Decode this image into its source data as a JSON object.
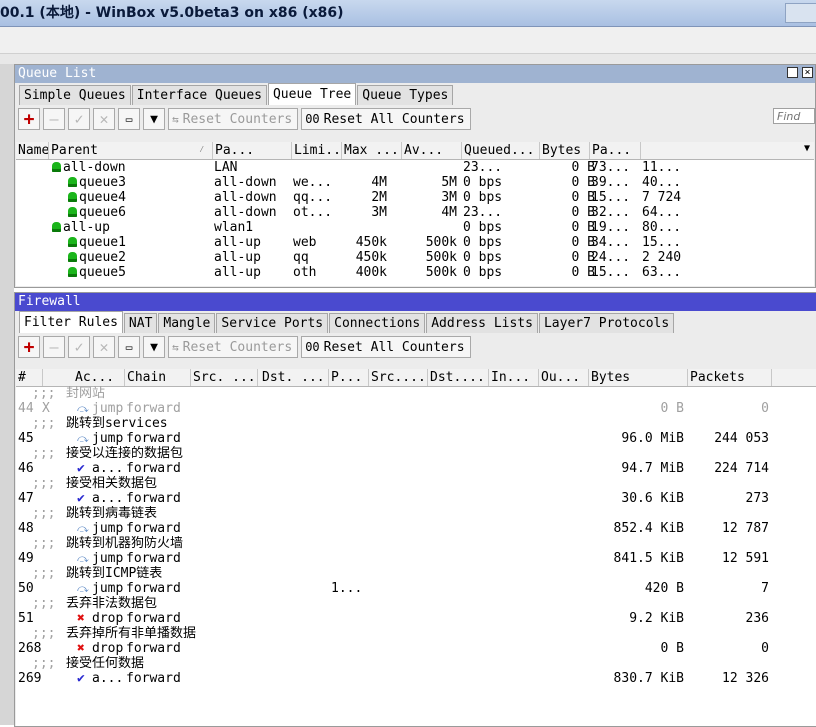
{
  "window": {
    "title": "00.1 (本地) - WinBox v5.0beta3 on x86 (x86)"
  },
  "queue_panel": {
    "title": "Queue List",
    "tabs": [
      "Simple Queues",
      "Interface Queues",
      "Queue Tree",
      "Queue Types"
    ],
    "active_tab": "Queue Tree",
    "reset_counters": "Reset Counters",
    "reset_all_prefix": "00",
    "reset_all": "Reset All Counters",
    "find_placeholder": "Find",
    "columns": [
      "Name",
      "Parent",
      "Pa...",
      "Limi...",
      "Max ...",
      "Av...",
      "Queued...",
      "Bytes",
      "Pa..."
    ],
    "rows": [
      {
        "name": "all-down",
        "parent": "LAN",
        "packet": "",
        "limit": "",
        "max": "",
        "avg": "23...",
        "queued": "0 B",
        "bytes": "73...",
        "packets": "11...",
        "level": 0
      },
      {
        "name": "queue3",
        "parent": "all-down",
        "packet": "we...",
        "limit": "4M",
        "max": "5M",
        "avg": "0 bps",
        "queued": "0 B",
        "bytes": "39...",
        "packets": "40...",
        "level": 1
      },
      {
        "name": "queue4",
        "parent": "all-down",
        "packet": "qq...",
        "limit": "2M",
        "max": "3M",
        "avg": "0 bps",
        "queued": "0 B",
        "bytes": "15...",
        "packets": "7 724",
        "level": 1
      },
      {
        "name": "queue6",
        "parent": "all-down",
        "packet": "ot...",
        "limit": "3M",
        "max": "4M",
        "avg": "23...",
        "queued": "0 B",
        "bytes": "32...",
        "packets": "64...",
        "level": 1
      },
      {
        "name": "all-up",
        "parent": "wlan1",
        "packet": "",
        "limit": "",
        "max": "",
        "avg": "0 bps",
        "queued": "0 B",
        "bytes": "19...",
        "packets": "80...",
        "level": 0
      },
      {
        "name": "queue1",
        "parent": "all-up",
        "packet": "web",
        "limit": "450k",
        "max": "500k",
        "avg": "0 bps",
        "queued": "0 B",
        "bytes": "34...",
        "packets": "15...",
        "level": 1
      },
      {
        "name": "queue2",
        "parent": "all-up",
        "packet": "qq",
        "limit": "450k",
        "max": "500k",
        "avg": "0 bps",
        "queued": "0 B",
        "bytes": "24...",
        "packets": "2 240",
        "level": 1
      },
      {
        "name": "queue5",
        "parent": "all-up",
        "packet": "oth",
        "limit": "400k",
        "max": "500k",
        "avg": "0 bps",
        "queued": "0 B",
        "bytes": "15...",
        "packets": "63...",
        "level": 1
      }
    ]
  },
  "firewall_panel": {
    "title": "Firewall",
    "tabs": [
      "Filter Rules",
      "NAT",
      "Mangle",
      "Service Ports",
      "Connections",
      "Address Lists",
      "Layer7 Protocols"
    ],
    "active_tab": "Filter Rules",
    "reset_counters": "Reset Counters",
    "reset_all_prefix": "00",
    "reset_all": "Reset All Counters",
    "columns": [
      "#",
      "Ac...",
      "Chain",
      "Src. ...",
      "Dst. ...",
      "P...",
      "Src....",
      "Dst....",
      "In...",
      "Ou...",
      "Bytes",
      "Packets"
    ],
    "comment_prefix": ";;;",
    "rules": [
      {
        "comment": "封网站",
        "num": "44",
        "flag": "X",
        "action": "jump",
        "icon": "jump",
        "chain": "forward",
        "proto": "",
        "bytes": "0 B",
        "packets": "0",
        "disabled": true
      },
      {
        "comment": "跳转到services",
        "num": "45",
        "flag": "",
        "action": "jump",
        "icon": "jump",
        "chain": "forward",
        "proto": "",
        "bytes": "96.0 MiB",
        "packets": "244 053",
        "disabled": false
      },
      {
        "comment": "接受以连接的数据包",
        "num": "46",
        "flag": "",
        "action": "a...",
        "icon": "accept",
        "chain": "forward",
        "proto": "",
        "bytes": "94.7 MiB",
        "packets": "224 714",
        "disabled": false
      },
      {
        "comment": "接受相关数据包",
        "num": "47",
        "flag": "",
        "action": "a...",
        "icon": "accept",
        "chain": "forward",
        "proto": "",
        "bytes": "30.6 KiB",
        "packets": "273",
        "disabled": false
      },
      {
        "comment": "跳转到病毒链表",
        "num": "48",
        "flag": "",
        "action": "jump",
        "icon": "jump",
        "chain": "forward",
        "proto": "",
        "bytes": "852.4 KiB",
        "packets": "12 787",
        "disabled": false
      },
      {
        "comment": "跳转到机器狗防火墙",
        "num": "49",
        "flag": "",
        "action": "jump",
        "icon": "jump",
        "chain": "forward",
        "proto": "",
        "bytes": "841.5 KiB",
        "packets": "12 591",
        "disabled": false
      },
      {
        "comment": "跳转到ICMP链表",
        "num": "50",
        "flag": "",
        "action": "jump",
        "icon": "jump",
        "chain": "forward",
        "proto": "1...",
        "bytes": "420 B",
        "packets": "7",
        "disabled": false
      },
      {
        "comment": "丢弃非法数据包",
        "num": "51",
        "flag": "",
        "action": "drop",
        "icon": "drop",
        "chain": "forward",
        "proto": "",
        "bytes": "9.2 KiB",
        "packets": "236",
        "disabled": false
      },
      {
        "comment": "丢弃掉所有非单播数据",
        "num": "268",
        "flag": "",
        "action": "drop",
        "icon": "drop",
        "chain": "forward",
        "proto": "",
        "bytes": "0 B",
        "packets": "0",
        "disabled": false
      },
      {
        "comment": "接受任何数据",
        "num": "269",
        "flag": "",
        "action": "a...",
        "icon": "accept",
        "chain": "forward",
        "proto": "",
        "bytes": "830.7 KiB",
        "packets": "12 326",
        "disabled": false
      }
    ]
  },
  "colors": {
    "queue_title_bg": "#9fb3d1",
    "firewall_title_bg": "#4a4acf",
    "titlebar": "#b7cbe8"
  }
}
